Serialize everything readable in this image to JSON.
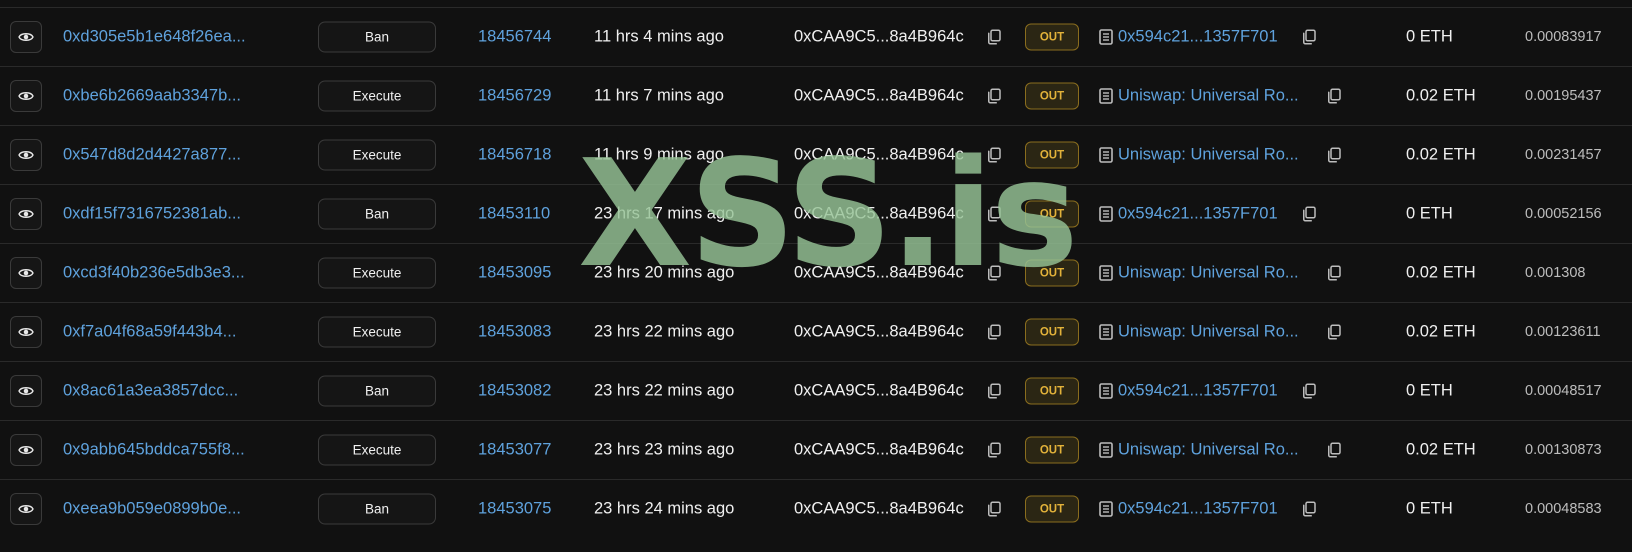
{
  "colors": {
    "background": "#111111",
    "link": "#5fa2dd",
    "text": "#f0f0f0",
    "muted": "#bdbdbd",
    "out_badge": "#e2b23a",
    "watermark": "#96c396"
  },
  "icons": {
    "view": "eye-icon",
    "copy": "copy-icon",
    "contract": "document-icon"
  },
  "watermark": "XSS.is",
  "rows": [
    {
      "hash": "0xd305e5b1e648f26ea...",
      "method": "Ban",
      "block": "18456744",
      "age": "11 hrs 4 mins ago",
      "from": "0xCAA9C5...8a4B964c",
      "direction": "OUT",
      "to": "0x594c21...1357F701",
      "value": "0 ETH",
      "fee": "0.00083917"
    },
    {
      "hash": "0xbe6b2669aab3347b...",
      "method": "Execute",
      "block": "18456729",
      "age": "11 hrs 7 mins ago",
      "from": "0xCAA9C5...8a4B964c",
      "direction": "OUT",
      "to": "Uniswap: Universal Ro...",
      "value": "0.02 ETH",
      "fee": "0.00195437"
    },
    {
      "hash": "0x547d8d2d4427a877...",
      "method": "Execute",
      "block": "18456718",
      "age": "11 hrs 9 mins ago",
      "from": "0xCAA9C5...8a4B964c",
      "direction": "OUT",
      "to": "Uniswap: Universal Ro...",
      "value": "0.02 ETH",
      "fee": "0.00231457"
    },
    {
      "hash": "0xdf15f7316752381ab...",
      "method": "Ban",
      "block": "18453110",
      "age": "23 hrs 17 mins ago",
      "from": "0xCAA9C5...8a4B964c",
      "direction": "OUT",
      "to": "0x594c21...1357F701",
      "value": "0 ETH",
      "fee": "0.00052156"
    },
    {
      "hash": "0xcd3f40b236e5db3e3...",
      "method": "Execute",
      "block": "18453095",
      "age": "23 hrs 20 mins ago",
      "from": "0xCAA9C5...8a4B964c",
      "direction": "OUT",
      "to": "Uniswap: Universal Ro...",
      "value": "0.02 ETH",
      "fee": "0.001308"
    },
    {
      "hash": "0xf7a04f68a59f443b4...",
      "method": "Execute",
      "block": "18453083",
      "age": "23 hrs 22 mins ago",
      "from": "0xCAA9C5...8a4B964c",
      "direction": "OUT",
      "to": "Uniswap: Universal Ro...",
      "value": "0.02 ETH",
      "fee": "0.00123611"
    },
    {
      "hash": "0x8ac61a3ea3857dcc...",
      "method": "Ban",
      "block": "18453082",
      "age": "23 hrs 22 mins ago",
      "from": "0xCAA9C5...8a4B964c",
      "direction": "OUT",
      "to": "0x594c21...1357F701",
      "value": "0 ETH",
      "fee": "0.00048517"
    },
    {
      "hash": "0x9abb645bddca755f8...",
      "method": "Execute",
      "block": "18453077",
      "age": "23 hrs 23 mins ago",
      "from": "0xCAA9C5...8a4B964c",
      "direction": "OUT",
      "to": "Uniswap: Universal Ro...",
      "value": "0.02 ETH",
      "fee": "0.00130873"
    },
    {
      "hash": "0xeea9b059e0899b0e...",
      "method": "Ban",
      "block": "18453075",
      "age": "23 hrs 24 mins ago",
      "from": "0xCAA9C5...8a4B964c",
      "direction": "OUT",
      "to": "0x594c21...1357F701",
      "value": "0 ETH",
      "fee": "0.00048583"
    }
  ]
}
